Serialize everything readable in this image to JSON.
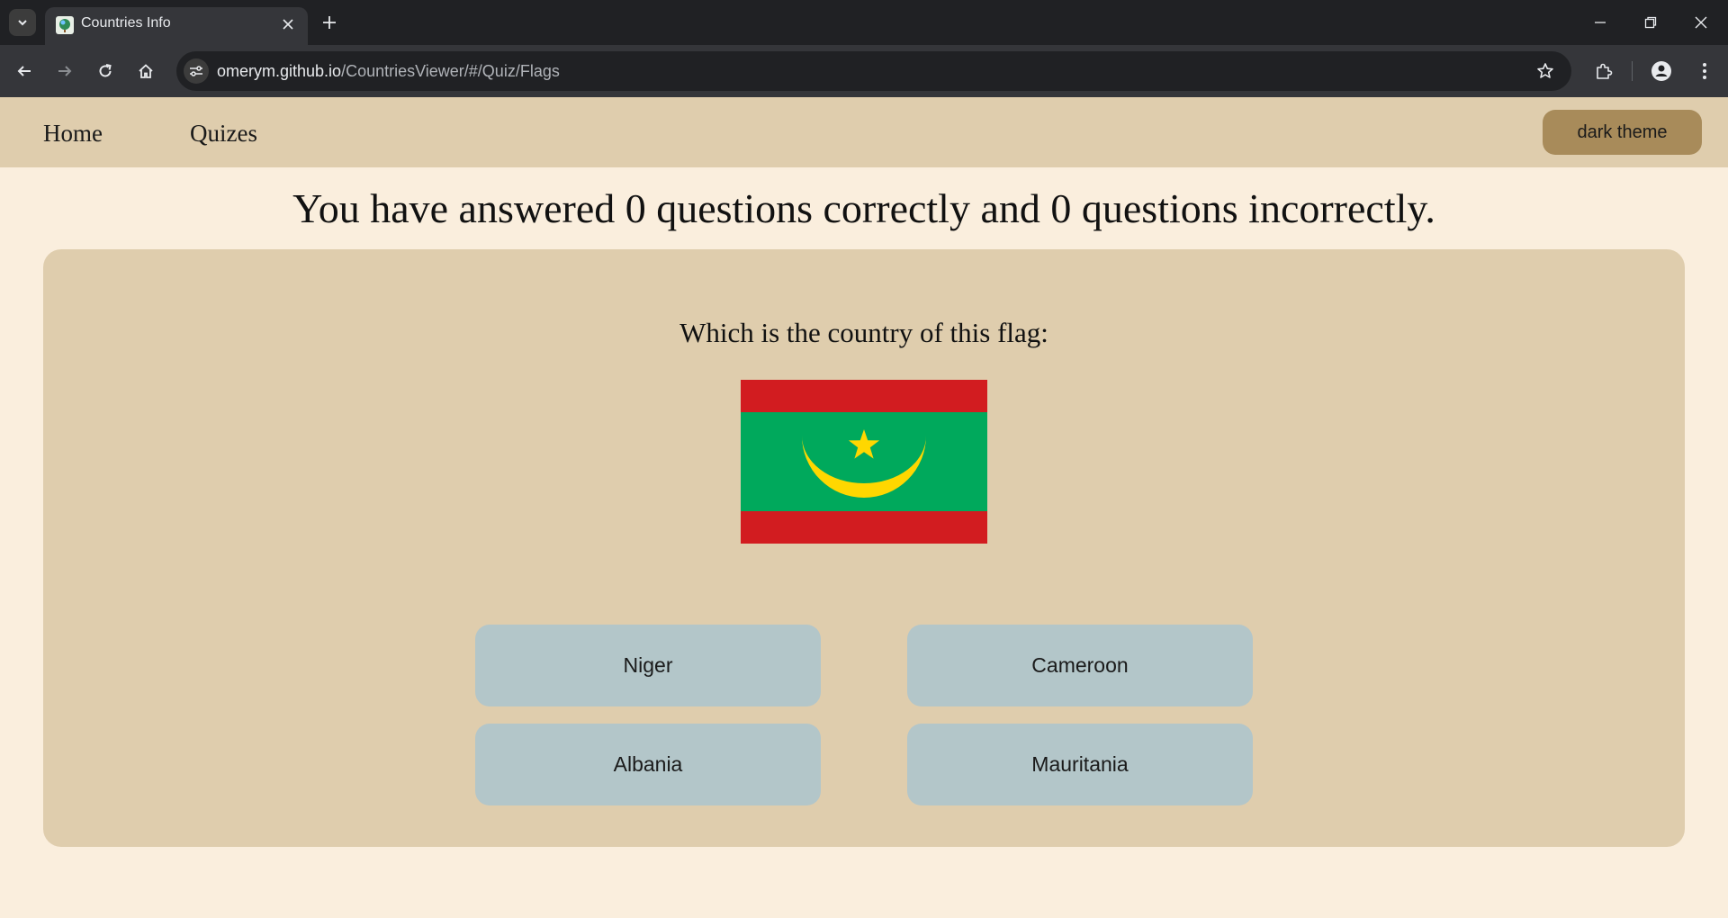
{
  "browser": {
    "tab_title": "Countries Info",
    "url_host": "omerym.github.io",
    "url_path": "/CountriesViewer/#/Quiz/Flags"
  },
  "nav": {
    "home_label": "Home",
    "quizzes_label": "Quizes",
    "theme_button_label": "dark theme"
  },
  "score": {
    "text": "You have answered 0 questions correctly and 0 questions incorrectly.",
    "correct": 0,
    "incorrect": 0
  },
  "quiz": {
    "question": "Which is the country of this flag:",
    "flag": {
      "colors": {
        "red": "#d21c20",
        "green": "#00a95c",
        "gold": "#ffd700"
      }
    },
    "answers": [
      "Niger",
      "Cameroon",
      "Albania",
      "Mauritania"
    ]
  },
  "colors": {
    "page_background": "#faeedd",
    "nav_background": "#dfcdad",
    "card_background": "#dfcdad",
    "theme_button": "#a88b5a",
    "answer_button": "#b3c6c9"
  }
}
